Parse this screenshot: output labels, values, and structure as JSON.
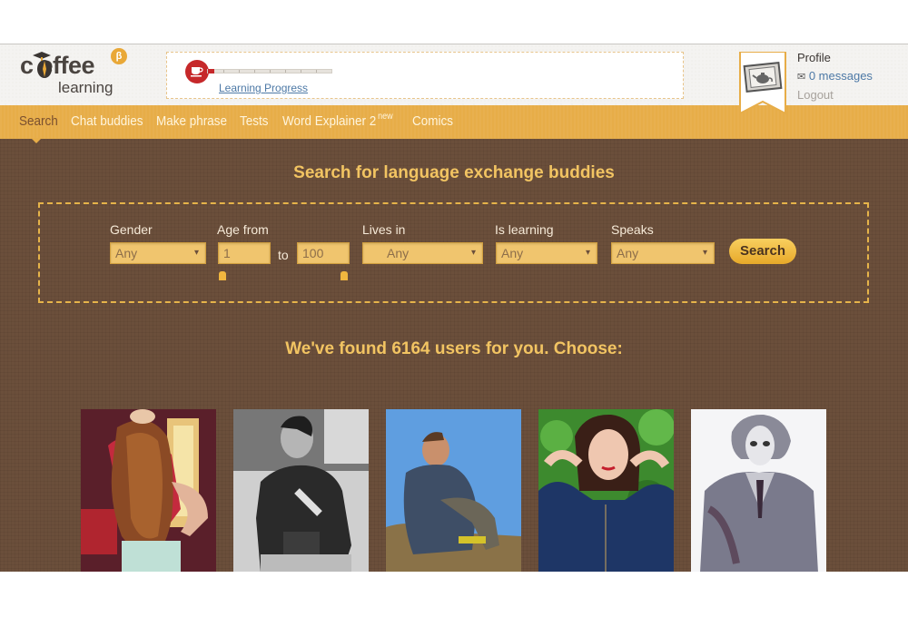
{
  "header": {
    "logo_word": "c  effee",
    "logo_sub": "learning",
    "beta_label": "β",
    "progress": {
      "label": "Learning Progress",
      "value_percent": 5,
      "ticks": 8
    },
    "user": {
      "profile_label": "Profile",
      "messages_label": "0 messages",
      "logout_label": "Logout"
    }
  },
  "nav": {
    "items": [
      {
        "label": "Search",
        "active": true
      },
      {
        "label": "Chat buddies"
      },
      {
        "label": "Make phrase"
      },
      {
        "label": "Tests"
      },
      {
        "label": "Word Explainer 2",
        "badge": "new"
      },
      {
        "label": "Comics"
      }
    ]
  },
  "search": {
    "title": "Search for language exchange buddies",
    "gender": {
      "label": "Gender",
      "value": "Any"
    },
    "age": {
      "label": "Age from",
      "from": "1",
      "to_label": "to",
      "to": "100"
    },
    "lives_in": {
      "label": "Lives in",
      "value": "Any"
    },
    "is_learning": {
      "label": "Is learning",
      "value": "Any"
    },
    "speaks": {
      "label": "Speaks",
      "value": "Any"
    },
    "button_label": "Search"
  },
  "results": {
    "title": "We've found 6164 users for you. Choose:",
    "count": 6164,
    "photos": [
      {
        "description": "woman with long curly hair, back turned, red top"
      },
      {
        "description": "man in black and white with camera"
      },
      {
        "description": "man sitting outdoors against blue sky"
      },
      {
        "description": "smiling woman in blue top, green leaves"
      },
      {
        "description": "sketch of the Joker"
      }
    ]
  },
  "colors": {
    "nav": "#e7ad48",
    "content_bg": "#6b4f3b",
    "title": "#f2c462",
    "progress": "#c6282a",
    "link": "#4d79a6"
  }
}
